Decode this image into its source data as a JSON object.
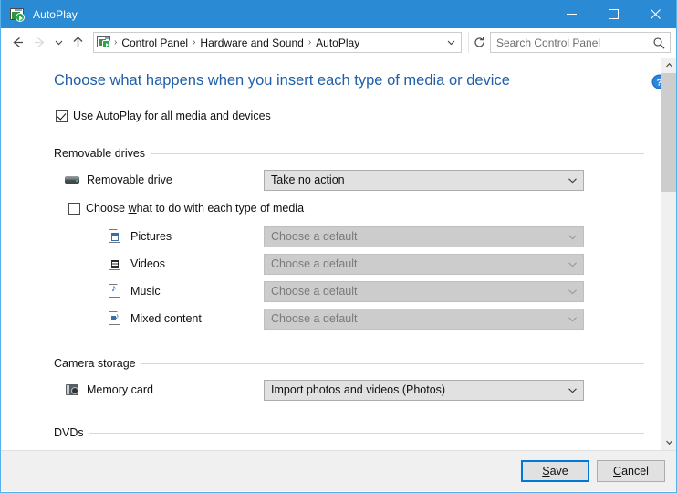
{
  "window": {
    "title": "AutoPlay",
    "title_icon": "autoplay-window-icon",
    "minimize_icon": "minimize-icon",
    "maximize_icon": "maximize-icon",
    "close_icon": "close-icon"
  },
  "navbar": {
    "back_icon": "back-arrow-icon",
    "forward_icon": "forward-arrow-icon",
    "recent_icon": "recent-locations-chevron-icon",
    "up_icon": "up-arrow-icon",
    "breadcrumb_icon": "autoplay-window-icon",
    "breadcrumbs": [
      "Control Panel",
      "Hardware and Sound",
      "AutoPlay"
    ],
    "separator": "›",
    "address_chevron_icon": "address-dropdown-chevron-icon",
    "refresh_icon": "refresh-icon",
    "search": {
      "value": "",
      "placeholder": "Search Control Panel",
      "icon": "search-icon"
    }
  },
  "content": {
    "page_title": "Choose what happens when you insert each type of media or device",
    "help_icon": "help-question-icon",
    "master_checkbox": {
      "label_prefix": "",
      "accel": "U",
      "label_rest": "se AutoPlay for all media and devices",
      "checked": true
    },
    "sections": [
      {
        "header": "Removable drives",
        "rows": [
          {
            "icon": "removable-drive-icon",
            "label": "Removable drive",
            "value": "Take no action",
            "disabled": false
          }
        ],
        "subcheckbox": {
          "label_prefix": "Choose ",
          "accel": "w",
          "label_rest": "hat to do with each type of media",
          "checked": false
        },
        "subrows": [
          {
            "icon": "pictures-icon",
            "label": "Pictures",
            "value": "Choose a default",
            "disabled": true
          },
          {
            "icon": "videos-icon",
            "label": "Videos",
            "value": "Choose a default",
            "disabled": true
          },
          {
            "icon": "music-icon",
            "label": "Music",
            "value": "Choose a default",
            "disabled": true
          },
          {
            "icon": "mixed-content-icon",
            "label": "Mixed content",
            "value": "Choose a default",
            "disabled": true
          }
        ]
      },
      {
        "header": "Camera storage",
        "rows": [
          {
            "icon": "memory-card-icon",
            "label": "Memory card",
            "value": "Import photos and videos (Photos)",
            "disabled": false
          }
        ]
      },
      {
        "header": "DVDs",
        "rows": []
      }
    ]
  },
  "scrollbar": {
    "up_icon": "scroll-up-arrow-icon",
    "down_icon": "scroll-down-arrow-icon"
  },
  "footer": {
    "save": {
      "accel": "S",
      "rest": "ave"
    },
    "cancel": {
      "accel": "C",
      "rest": "ancel"
    }
  },
  "colors": {
    "titlebar": "#2a8ad4",
    "accent": "#0078d7",
    "heading": "#1f5fa8",
    "combo_bg": "#e1e1e1",
    "combo_disabled_bg": "#cccccc"
  }
}
